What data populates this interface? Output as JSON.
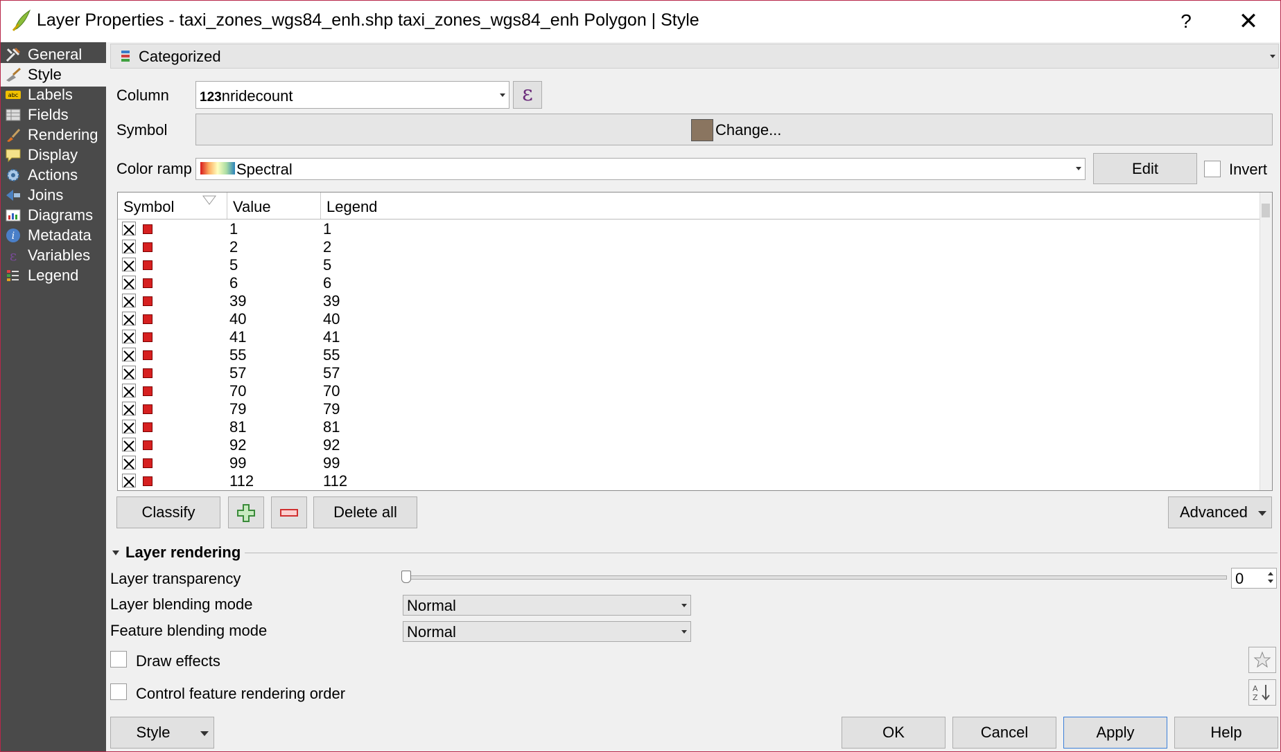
{
  "window": {
    "title": "Layer Properties - taxi_zones_wgs84_enh.shp taxi_zones_wgs84_enh Polygon | Style",
    "help_label": "?",
    "close_label": "✕"
  },
  "sidebar": {
    "items": [
      {
        "label": "General",
        "icon": "wrench-icon"
      },
      {
        "label": "Style",
        "icon": "paintbrush-icon"
      },
      {
        "label": "Labels",
        "icon": "abc-label-icon"
      },
      {
        "label": "Fields",
        "icon": "table-icon"
      },
      {
        "label": "Rendering",
        "icon": "brush-icon"
      },
      {
        "label": "Display",
        "icon": "speech-bubble-icon"
      },
      {
        "label": "Actions",
        "icon": "gear-icon"
      },
      {
        "label": "Joins",
        "icon": "join-icon"
      },
      {
        "label": "Diagrams",
        "icon": "diagram-icon"
      },
      {
        "label": "Metadata",
        "icon": "info-icon"
      },
      {
        "label": "Variables",
        "icon": "epsilon-icon"
      },
      {
        "label": "Legend",
        "icon": "legend-icon"
      }
    ],
    "active": "Style"
  },
  "renderer": {
    "value": "Categorized"
  },
  "column": {
    "label": "Column",
    "type_prefix": "123",
    "value": "nridecount",
    "expression_icon": "ε"
  },
  "symbol": {
    "label": "Symbol",
    "button_label": "Change...",
    "swatch_color": "#8a7560"
  },
  "color_ramp": {
    "label": "Color ramp",
    "value": "Spectral",
    "edit_label": "Edit",
    "invert_label": "Invert"
  },
  "table": {
    "headers": [
      "Symbol",
      "Value",
      "Legend"
    ],
    "symbol_color": "#d62020",
    "rows": [
      {
        "value": "1",
        "legend": "1"
      },
      {
        "value": "2",
        "legend": "2"
      },
      {
        "value": "5",
        "legend": "5"
      },
      {
        "value": "6",
        "legend": "6"
      },
      {
        "value": "39",
        "legend": "39"
      },
      {
        "value": "40",
        "legend": "40"
      },
      {
        "value": "41",
        "legend": "41"
      },
      {
        "value": "55",
        "legend": "55"
      },
      {
        "value": "57",
        "legend": "57"
      },
      {
        "value": "70",
        "legend": "70"
      },
      {
        "value": "79",
        "legend": "79"
      },
      {
        "value": "81",
        "legend": "81"
      },
      {
        "value": "92",
        "legend": "92"
      },
      {
        "value": "99",
        "legend": "99"
      },
      {
        "value": "112",
        "legend": "112"
      }
    ]
  },
  "actions": {
    "classify": "Classify",
    "delete_all": "Delete all",
    "advanced": "Advanced"
  },
  "layer_rendering": {
    "header": "Layer rendering",
    "transparency_label": "Layer transparency",
    "transparency_value": "0",
    "layer_blending_label": "Layer blending mode",
    "layer_blending_value": "Normal",
    "feature_blending_label": "Feature blending mode",
    "feature_blending_value": "Normal",
    "draw_effects_label": "Draw effects",
    "control_order_label": "Control feature rendering order"
  },
  "footer": {
    "style": "Style",
    "ok": "OK",
    "cancel": "Cancel",
    "apply": "Apply",
    "help": "Help"
  }
}
